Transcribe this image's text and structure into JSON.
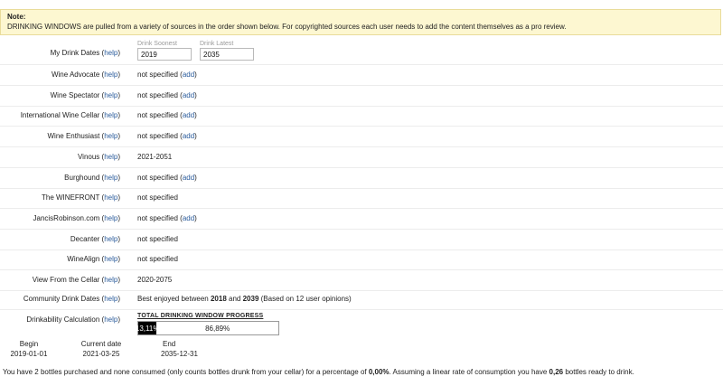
{
  "note": {
    "title": "Note:",
    "text": "DRINKING WINDOWS are pulled from a variety of sources in the order shown below. For copyrighted sources each user needs to add the content themselves as a pro review."
  },
  "help_label": "help",
  "add_label": "add",
  "my_dates": {
    "label": "My Drink Dates",
    "soonest_caption": "Drink Soonest",
    "soonest_value": "2019",
    "latest_caption": "Drink Latest",
    "latest_value": "2035"
  },
  "sources": [
    {
      "label": "Wine Advocate",
      "value": "not specified",
      "has_add": true
    },
    {
      "label": "Wine Spectator",
      "value": "not specified",
      "has_add": true
    },
    {
      "label": "International Wine Cellar",
      "value": "not specified",
      "has_add": true
    },
    {
      "label": "Wine Enthusiast",
      "value": "not specified",
      "has_add": true
    },
    {
      "label": "Vinous",
      "value": "2021-2051",
      "has_add": false
    },
    {
      "label": "Burghound",
      "value": "not specified",
      "has_add": true
    },
    {
      "label": "The WINEFRONT",
      "value": "not specified",
      "has_add": false
    },
    {
      "label": "JancisRobinson.com",
      "value": "not specified",
      "has_add": true
    },
    {
      "label": "Decanter",
      "value": "not specified",
      "has_add": false
    },
    {
      "label": "WineAlign",
      "value": "not specified",
      "has_add": false
    },
    {
      "label": "View From the Cellar",
      "value": "2020-2075",
      "has_add": false
    }
  ],
  "community": {
    "label": "Community Drink Dates",
    "prefix": "Best enjoyed between",
    "start": "2018",
    "middle": "and",
    "end": "2039",
    "suffix": "(Based on 12 user opinions)"
  },
  "drinkability": {
    "label": "Drinkability Calculation",
    "progress_title": "TOTAL DRINKING WINDOW PROGRESS",
    "progress_fraction": 0.1311,
    "done_text": "13,11%",
    "remaining_text": "86,89%",
    "begin_label": "Begin",
    "begin_date": "2019-01-01",
    "current_label": "Current date",
    "current_date": "2021-03-25",
    "end_label": "End",
    "end_date": "2035-12-31"
  },
  "summary": {
    "part1": "You have 2 bottles purchased and none consumed (only counts bottles drunk from your cellar) for a percentage of",
    "percentage": "0,00%",
    "part2": ". Assuming a linear rate of consumption you have",
    "ready": "0,26",
    "part3": "bottles ready to drink."
  }
}
